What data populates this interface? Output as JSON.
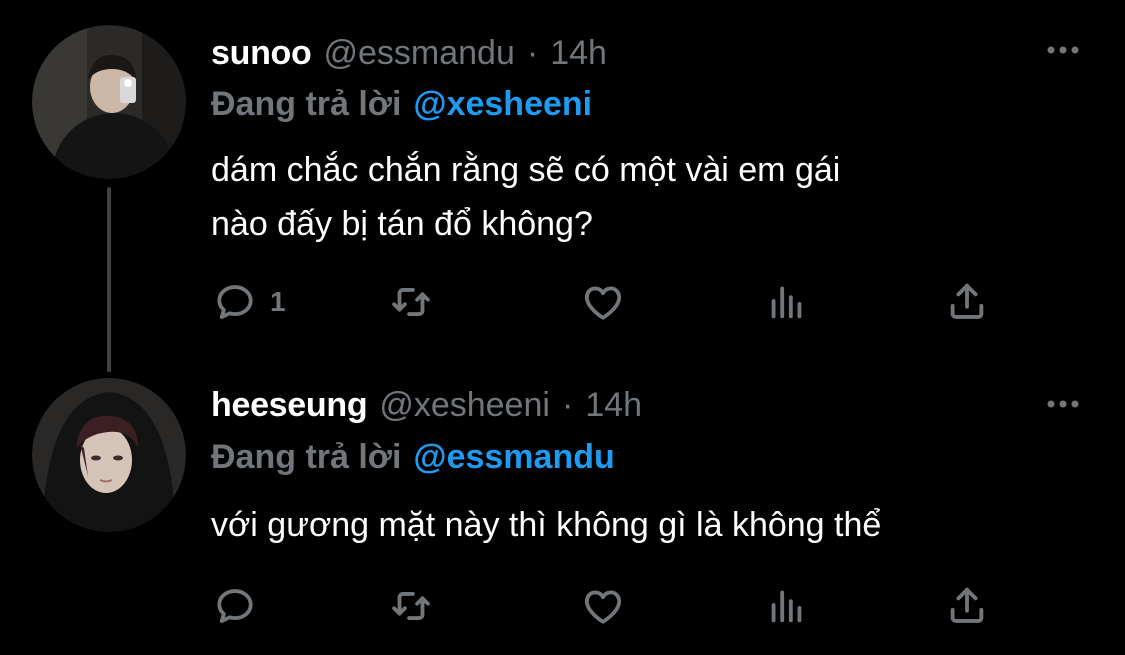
{
  "tweets": [
    {
      "display_name": "sunoo",
      "handle": "@essmandu",
      "separator": "·",
      "time": "14h",
      "reply_label": "Đang trả lời",
      "reply_to": "@xesheeni",
      "text_lines": [
        "dám chắc chắn rằng sẽ có một vài em gái",
        "nào đấy bị tán đổ không?"
      ],
      "reply_count": "1"
    },
    {
      "display_name": "heeseung",
      "handle": "@xesheeni",
      "separator": "·",
      "time": "14h",
      "reply_label": "Đang trả lời",
      "reply_to": "@essmandu",
      "text_lines": [
        "với gương mặt này thì không gì là không thể"
      ],
      "reply_count": ""
    }
  ],
  "icons": {
    "reply": "speech-bubble-icon",
    "retweet": "retweet-icon",
    "like": "heart-icon",
    "stats": "bar-chart-icon",
    "share": "share-icon",
    "more": "more-dots-icon"
  },
  "colors": {
    "background": "#000000",
    "text_primary": "#ffffff",
    "text_secondary": "#71767b",
    "accent": "#1d9bf0",
    "thread_line": "#3e4144"
  }
}
